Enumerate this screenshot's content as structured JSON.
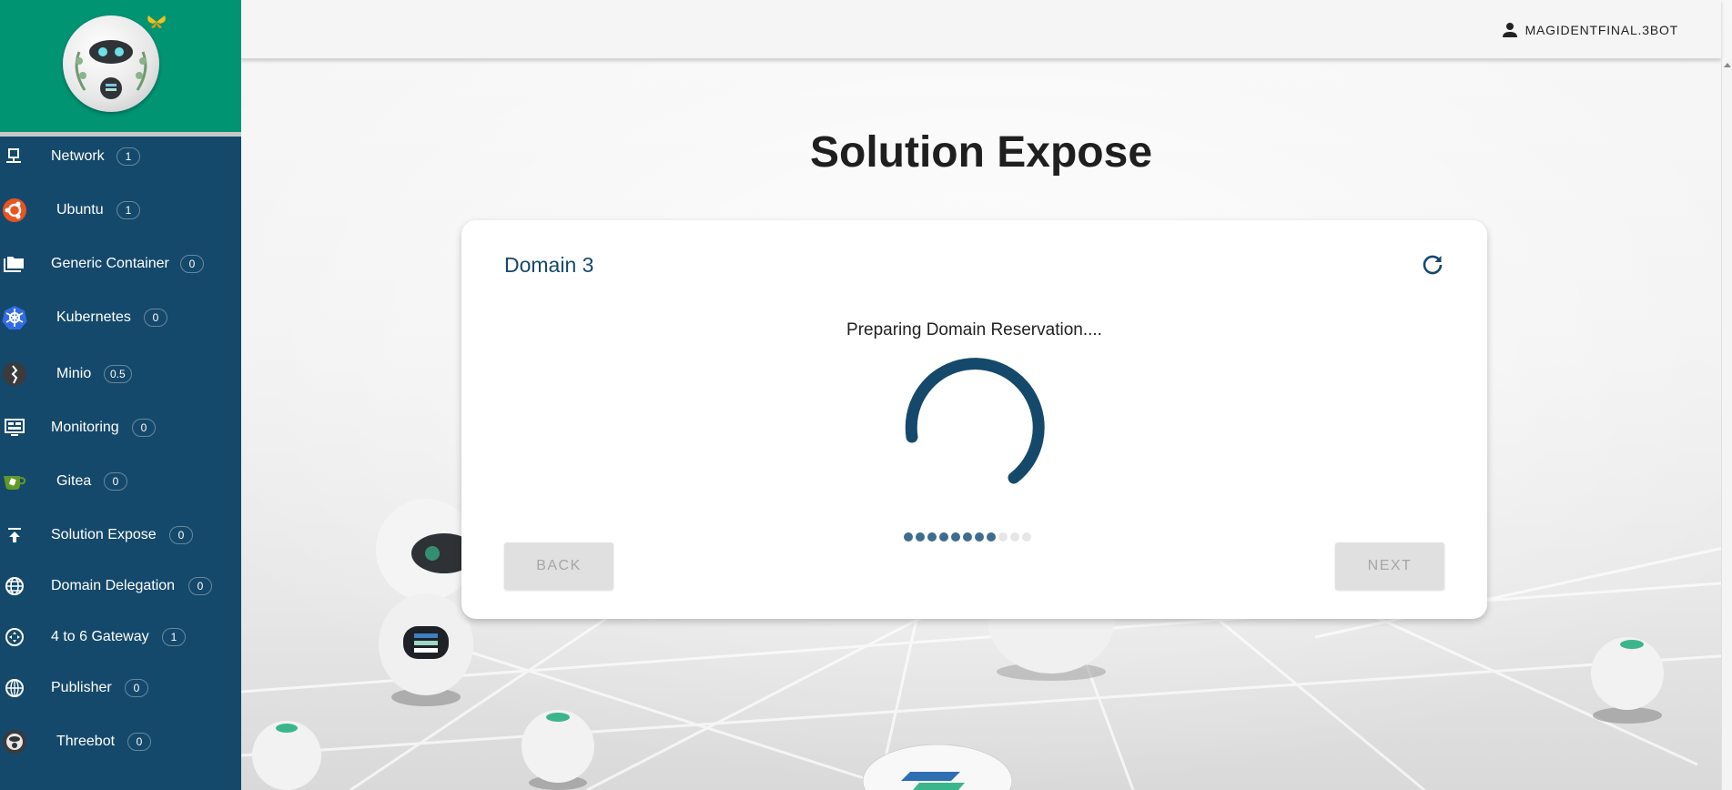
{
  "sidebar": {
    "items": [
      {
        "label": "Network",
        "badge": "1",
        "icon": "network-icon"
      },
      {
        "label": "Ubuntu",
        "badge": "1",
        "icon": "ubuntu-icon"
      },
      {
        "label": "Generic Container",
        "badge": "0",
        "icon": "folder-icon"
      },
      {
        "label": "Kubernetes",
        "badge": "0",
        "icon": "kubernetes-icon"
      },
      {
        "label": "Minio",
        "badge": "0.5",
        "icon": "minio-icon"
      },
      {
        "label": "Monitoring",
        "badge": "0",
        "icon": "monitor-icon"
      },
      {
        "label": "Gitea",
        "badge": "0",
        "icon": "gitea-icon"
      },
      {
        "label": "Solution Expose",
        "badge": "0",
        "icon": "upload-icon"
      },
      {
        "label": "Domain Delegation",
        "badge": "0",
        "icon": "globe-icon"
      },
      {
        "label": "4 to 6 Gateway",
        "badge": "1",
        "icon": "gateway-icon"
      },
      {
        "label": "Publisher",
        "badge": "0",
        "icon": "web-icon"
      },
      {
        "label": "Threebot",
        "badge": "0",
        "icon": "threebot-icon"
      }
    ]
  },
  "header": {
    "username": "MAGIDENTFINAL.3BOT"
  },
  "page": {
    "title": "Solution Expose"
  },
  "card": {
    "title": "Domain 3",
    "status": "Preparing Domain Reservation....",
    "back_label": "BACK",
    "next_label": "NEXT",
    "step_total": 11,
    "step_current": 8
  },
  "colors": {
    "sidebar": "#15496b",
    "logo_bg": "#009473",
    "accent": "#15496b"
  }
}
